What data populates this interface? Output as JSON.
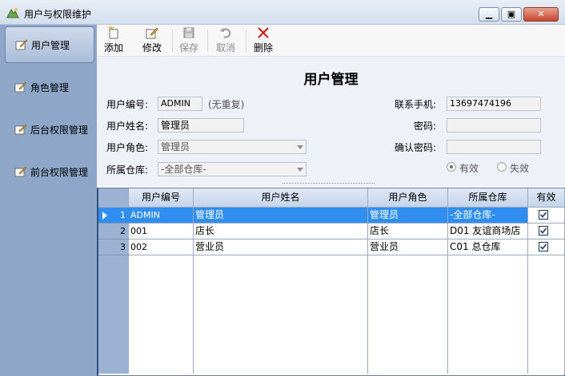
{
  "window": {
    "title": "用户与权限维护"
  },
  "sidebar": {
    "items": [
      {
        "label": "用户管理",
        "active": true
      },
      {
        "label": "角色管理",
        "active": false
      },
      {
        "label": "后台权限管理",
        "active": false
      },
      {
        "label": "前台权限管理",
        "active": false
      }
    ]
  },
  "toolbar": {
    "add_label": "添加",
    "edit_label": "修改",
    "save_label": "保存",
    "cancel_label": "取消",
    "delete_label": "删除"
  },
  "form": {
    "heading": "用户管理",
    "user_id_label": "用户编号:",
    "user_id_value": "ADMIN",
    "unique_hint": "(无重复)",
    "user_name_label": "用户姓名:",
    "user_name_value": "管理员",
    "role_label": "用户角色:",
    "role_value": "管理员",
    "warehouse_label": "所属仓库:",
    "warehouse_value": "-全部仓库-",
    "phone_label": "联系手机:",
    "phone_value": "13697474196",
    "password_label": "密码:",
    "password_value": "",
    "confirm_label": "确认密码:",
    "confirm_value": "",
    "status_valid_label": "有效",
    "status_invalid_label": "失效",
    "status_selected": "有效"
  },
  "grid": {
    "columns": [
      "用户编号",
      "用户姓名",
      "用户角色",
      "所属仓库",
      "有效"
    ],
    "rows": [
      {
        "num": "1",
        "id": "ADMIN",
        "name": "管理员",
        "role": "管理员",
        "warehouse": "-全部仓库-",
        "valid": true
      },
      {
        "num": "2",
        "id": "001",
        "name": "店长",
        "role": "店长",
        "warehouse": "D01 友谊商场店",
        "valid": true
      },
      {
        "num": "3",
        "id": "002",
        "name": "营业员",
        "role": "营业员",
        "warehouse": "C01 总仓库",
        "valid": true
      }
    ],
    "selected_row": 0
  },
  "colors": {
    "sidebar_bg": "#8ea6c8",
    "selection": "#2f8ef0",
    "form_bg": "#eef1f8"
  }
}
